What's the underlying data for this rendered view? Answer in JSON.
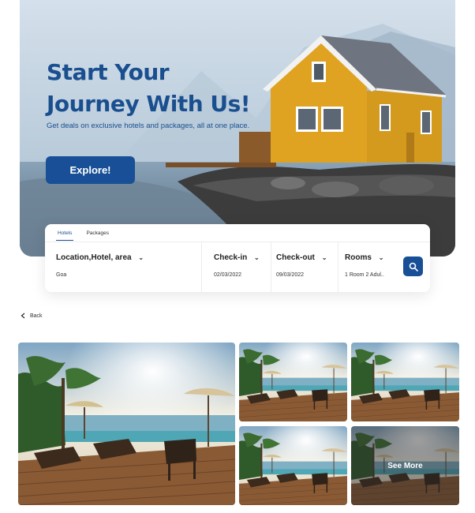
{
  "hero": {
    "title": "Start Your Journey With Us!",
    "subtitle": "Get deals on exclusive hotels and packages, all at one place.",
    "cta": "Explore!"
  },
  "search": {
    "tabs": [
      {
        "label": "Hotels",
        "active": true
      },
      {
        "label": "Packages",
        "active": false
      }
    ],
    "fields": [
      {
        "label": "Location,Hotel, area",
        "value": "Goa"
      },
      {
        "label": "Check-in",
        "value": "02/03/2022"
      },
      {
        "label": "Check-out",
        "value": "09/03/2022"
      },
      {
        "label": "Rooms",
        "value": "1 Room 2 Adul.."
      }
    ]
  },
  "nav": {
    "back_label": "Back"
  },
  "gallery": {
    "see_more_label": "See More"
  },
  "colors": {
    "brand": "#184f96",
    "title": "#1a4f8f",
    "house": "#e0a321"
  },
  "icons": [
    "chevron-down-icon",
    "search-icon",
    "chevron-left-icon"
  ]
}
